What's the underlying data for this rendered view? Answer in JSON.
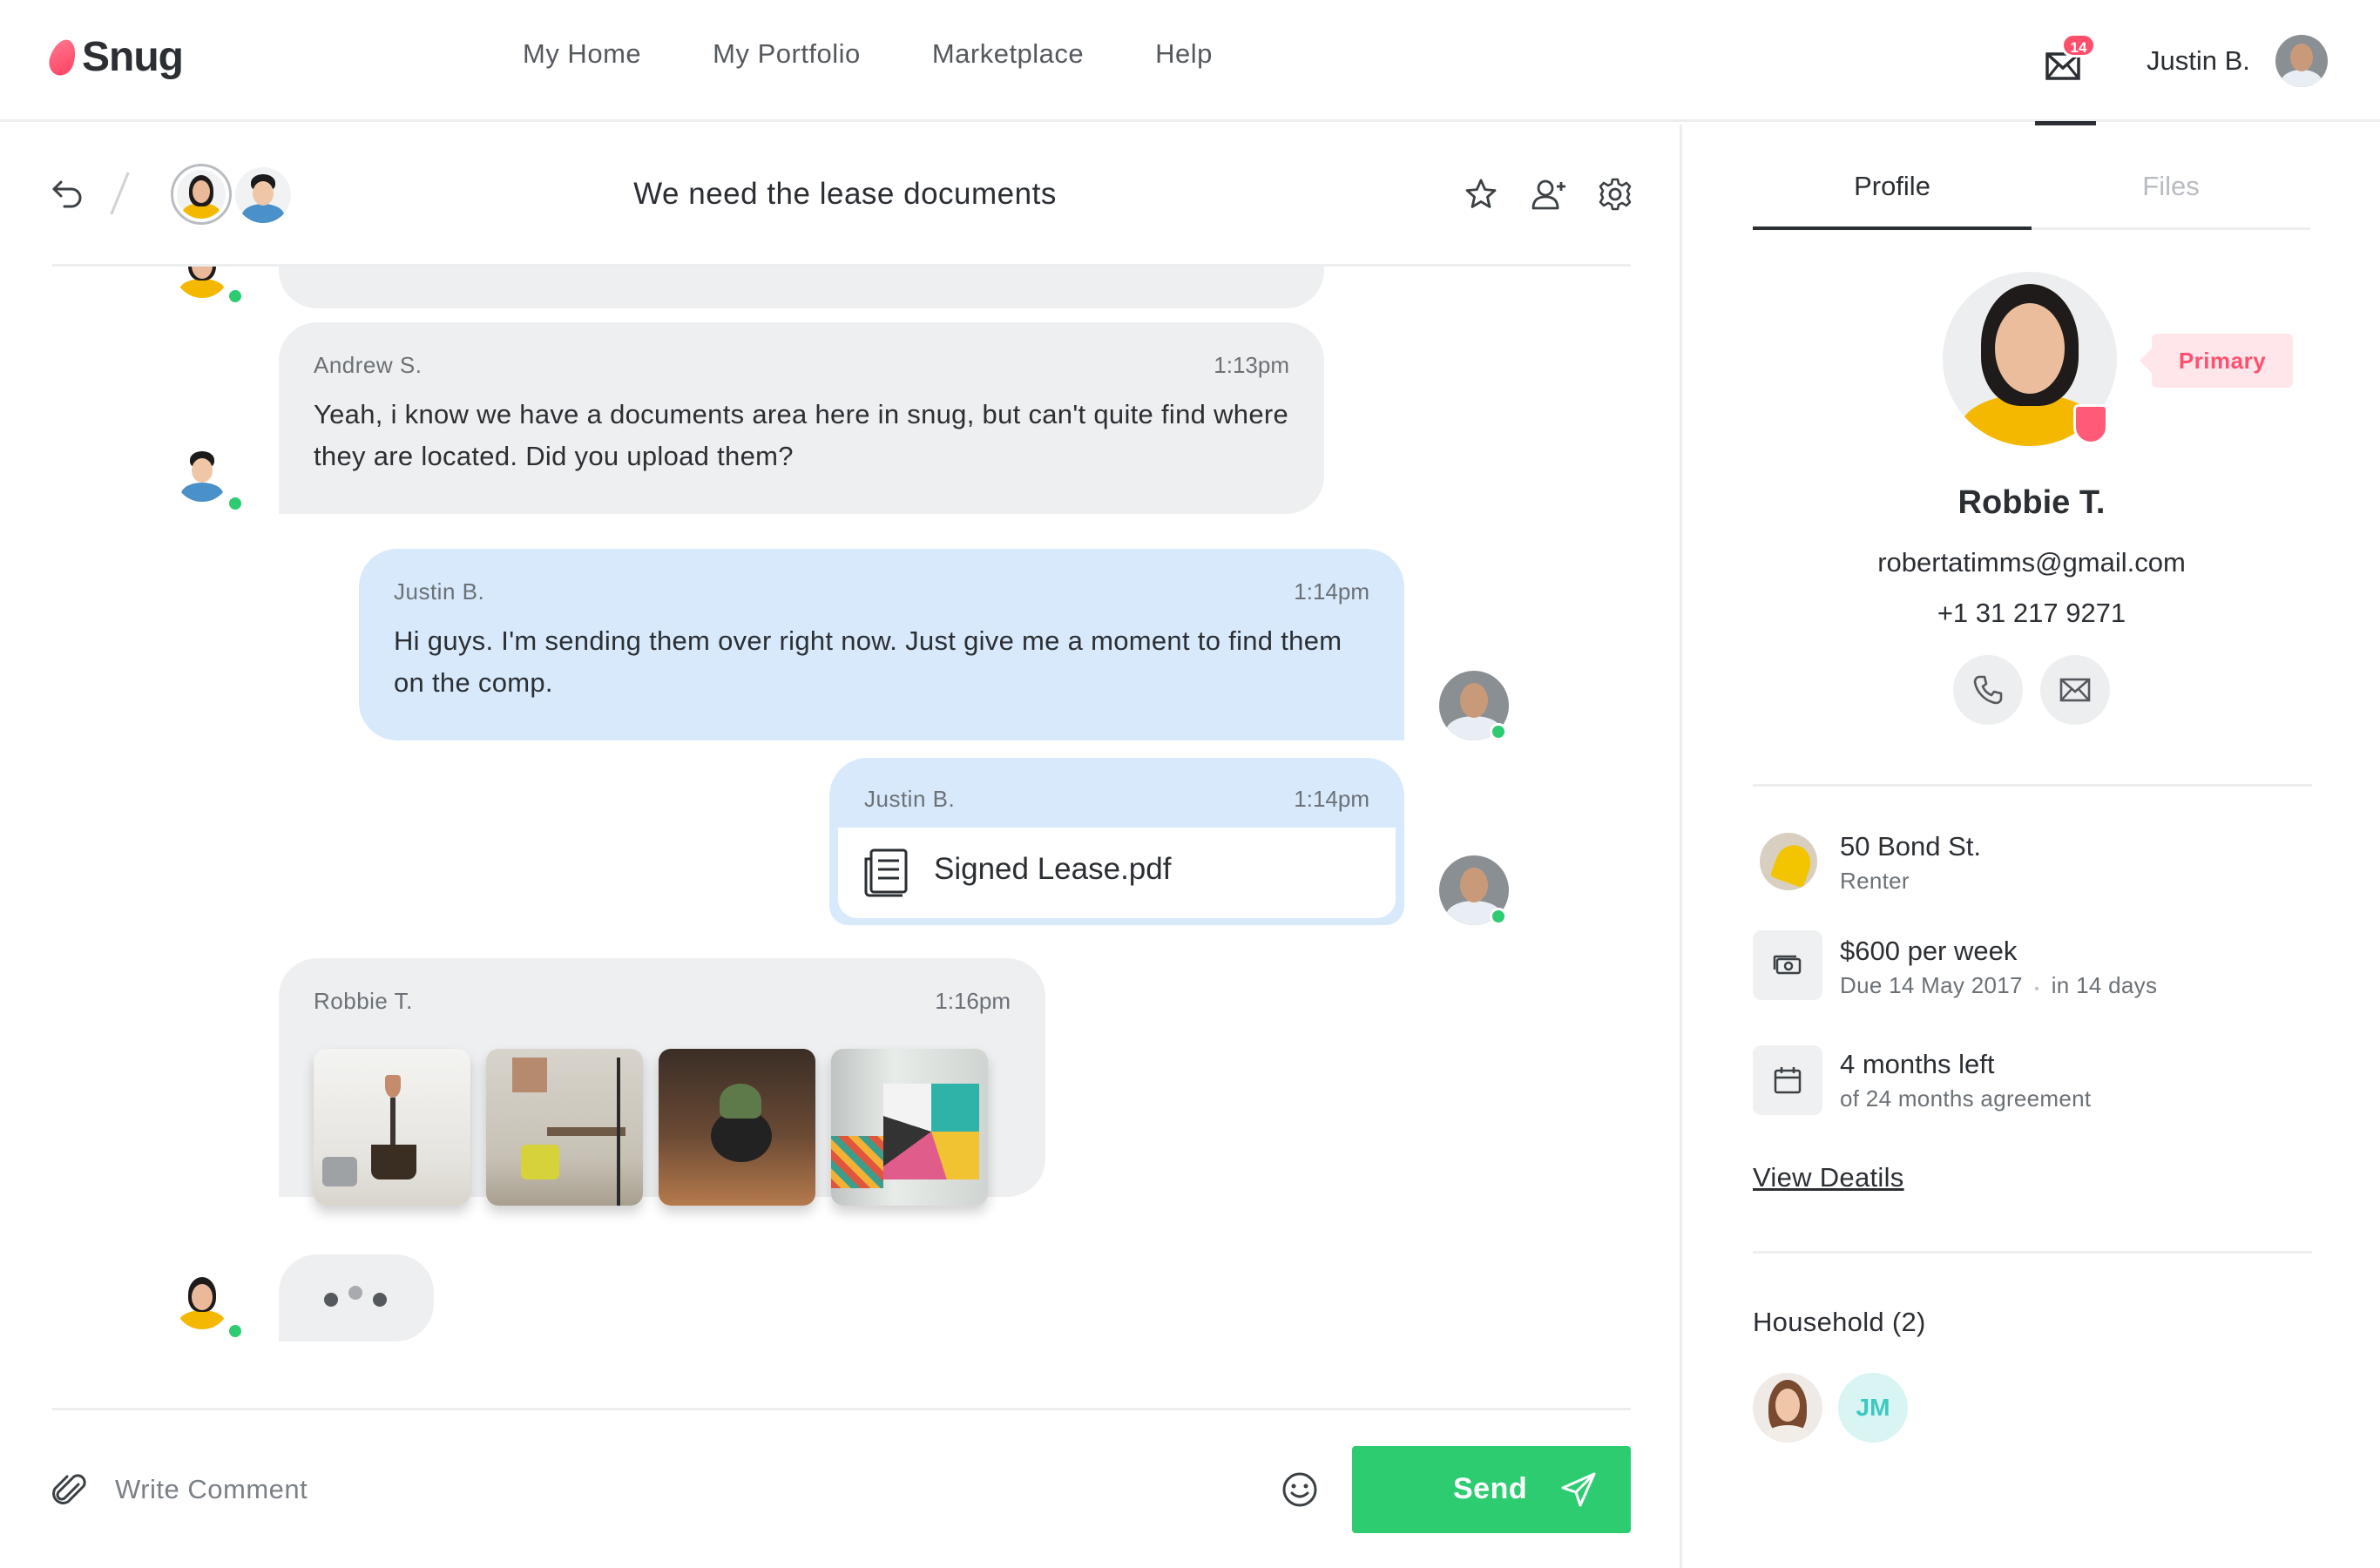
{
  "app": {
    "logo_text": "Snug",
    "brand_color": "#ff4d6a",
    "accent_color": "#2ecc71"
  },
  "nav": {
    "items": [
      "My Home",
      "My Portfolio",
      "Marketplace",
      "Help"
    ]
  },
  "header": {
    "unread_count": "14",
    "user_name": "Justin B."
  },
  "chat": {
    "title": "We need the lease documents",
    "messages": [
      {
        "author": "Andrew S.",
        "time": "1:13pm",
        "text": "Yeah, i know we have a documents area here in snug, but can't quite find where they are located. Did you upload them?"
      },
      {
        "author": "Justin B.",
        "time": "1:14pm",
        "text": "Hi guys. I'm sending them over right now. Just give me a moment to find them on the comp."
      },
      {
        "author": "Justin B.",
        "time": "1:14pm",
        "file_name": "Signed Lease.pdf"
      },
      {
        "author": "Robbie T.",
        "time": "1:16pm",
        "photo_count": 4
      }
    ],
    "typing": true
  },
  "composer": {
    "placeholder": "Write Comment",
    "send_label": "Send"
  },
  "profile": {
    "tabs": [
      "Profile",
      "Files"
    ],
    "active_tab": "Profile",
    "name": "Robbie T.",
    "email": "robertatimms@gmail.com",
    "phone": "+1 31 217 9271",
    "badge": "Primary",
    "property": {
      "title": "50 Bond St.",
      "subtitle": "Renter"
    },
    "rent": {
      "title": "$600 per week",
      "due": "Due 14 May 2017",
      "separator": "•",
      "in": "in 14 days"
    },
    "lease": {
      "title": "4 months left",
      "subtitle": "of 24 months agreement"
    },
    "view_details": "View Deatils",
    "household": {
      "label": "Household (2)",
      "members": [
        {
          "initials": ""
        },
        {
          "initials": "JM"
        }
      ]
    }
  }
}
